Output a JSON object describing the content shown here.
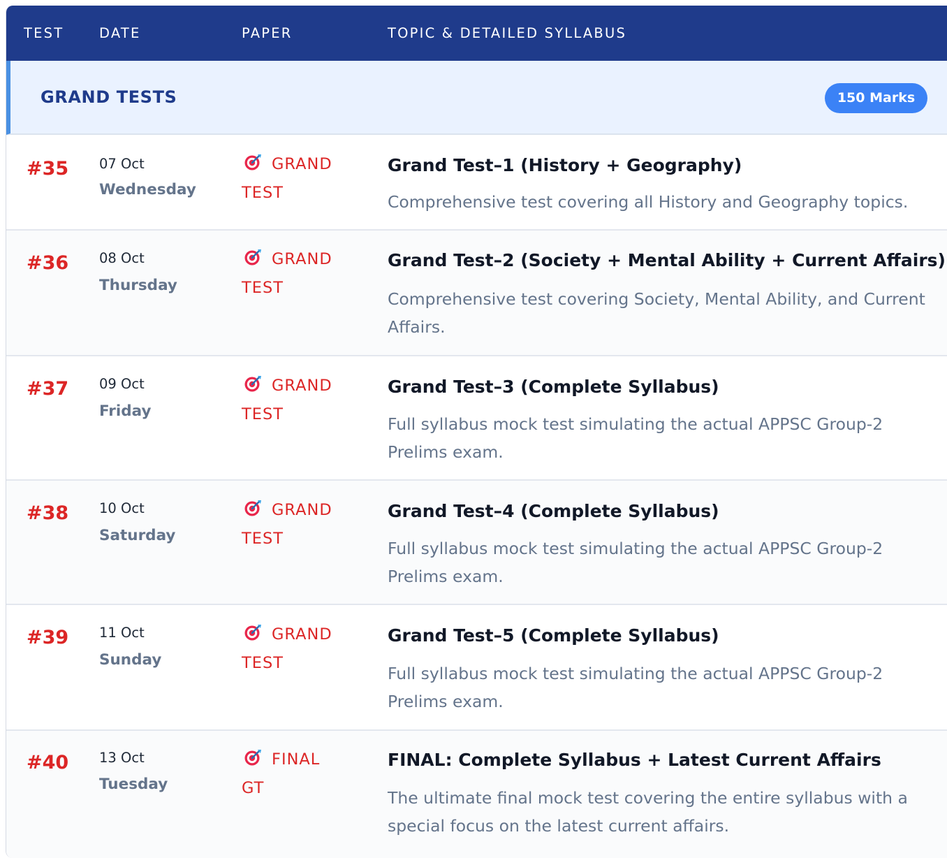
{
  "header": {
    "test": "TEST",
    "date": "DATE",
    "paper": "PAPER",
    "topic": "TOPIC & DETAILED SYLLABUS"
  },
  "section": {
    "title": "GRAND TESTS",
    "badge": "150 Marks"
  },
  "rows": [
    {
      "num": "#35",
      "date": "07 Oct",
      "day": "Wednesday",
      "paper_line1": "GRAND",
      "paper_line2": "TEST",
      "topic": "Grand Test–1 (History + Geography)",
      "desc": "Comprehensive test covering all History and Geography topics."
    },
    {
      "num": "#36",
      "date": "08 Oct",
      "day": "Thursday",
      "paper_line1": "GRAND",
      "paper_line2": "TEST",
      "topic": "Grand Test–2 (Society + Mental Ability + Current Affairs)",
      "desc": "Comprehensive test covering Society, Mental Ability, and Current Affairs."
    },
    {
      "num": "#37",
      "date": "09 Oct",
      "day": "Friday",
      "paper_line1": "GRAND",
      "paper_line2": "TEST",
      "topic": "Grand Test–3 (Complete Syllabus)",
      "desc": "Full syllabus mock test simulating the actual APPSC Group-2 Prelims exam."
    },
    {
      "num": "#38",
      "date": "10 Oct",
      "day": "Saturday",
      "paper_line1": "GRAND",
      "paper_line2": "TEST",
      "topic": "Grand Test–4 (Complete Syllabus)",
      "desc": "Full syllabus mock test simulating the actual APPSC Group-2 Prelims exam."
    },
    {
      "num": "#39",
      "date": "11 Oct",
      "day": "Sunday",
      "paper_line1": "GRAND",
      "paper_line2": "TEST",
      "topic": "Grand Test–5 (Complete Syllabus)",
      "desc": "Full syllabus mock test simulating the actual APPSC Group-2 Prelims exam."
    },
    {
      "num": "#40",
      "date": "13 Oct",
      "day": "Tuesday",
      "paper_line1": "FINAL",
      "paper_line2": "GT",
      "topic": "FINAL: Complete Syllabus + Latest Current Affairs",
      "desc": "The ultimate final mock test covering the entire syllabus with a special focus on the latest current affairs."
    }
  ],
  "icons": {
    "paper_icon": "target-dart-icon"
  },
  "colors": {
    "header_bg": "#1f3b8b",
    "section_bg": "#eaf2ff",
    "accent_blue": "#3b82f6",
    "test_red": "#dc2626"
  }
}
